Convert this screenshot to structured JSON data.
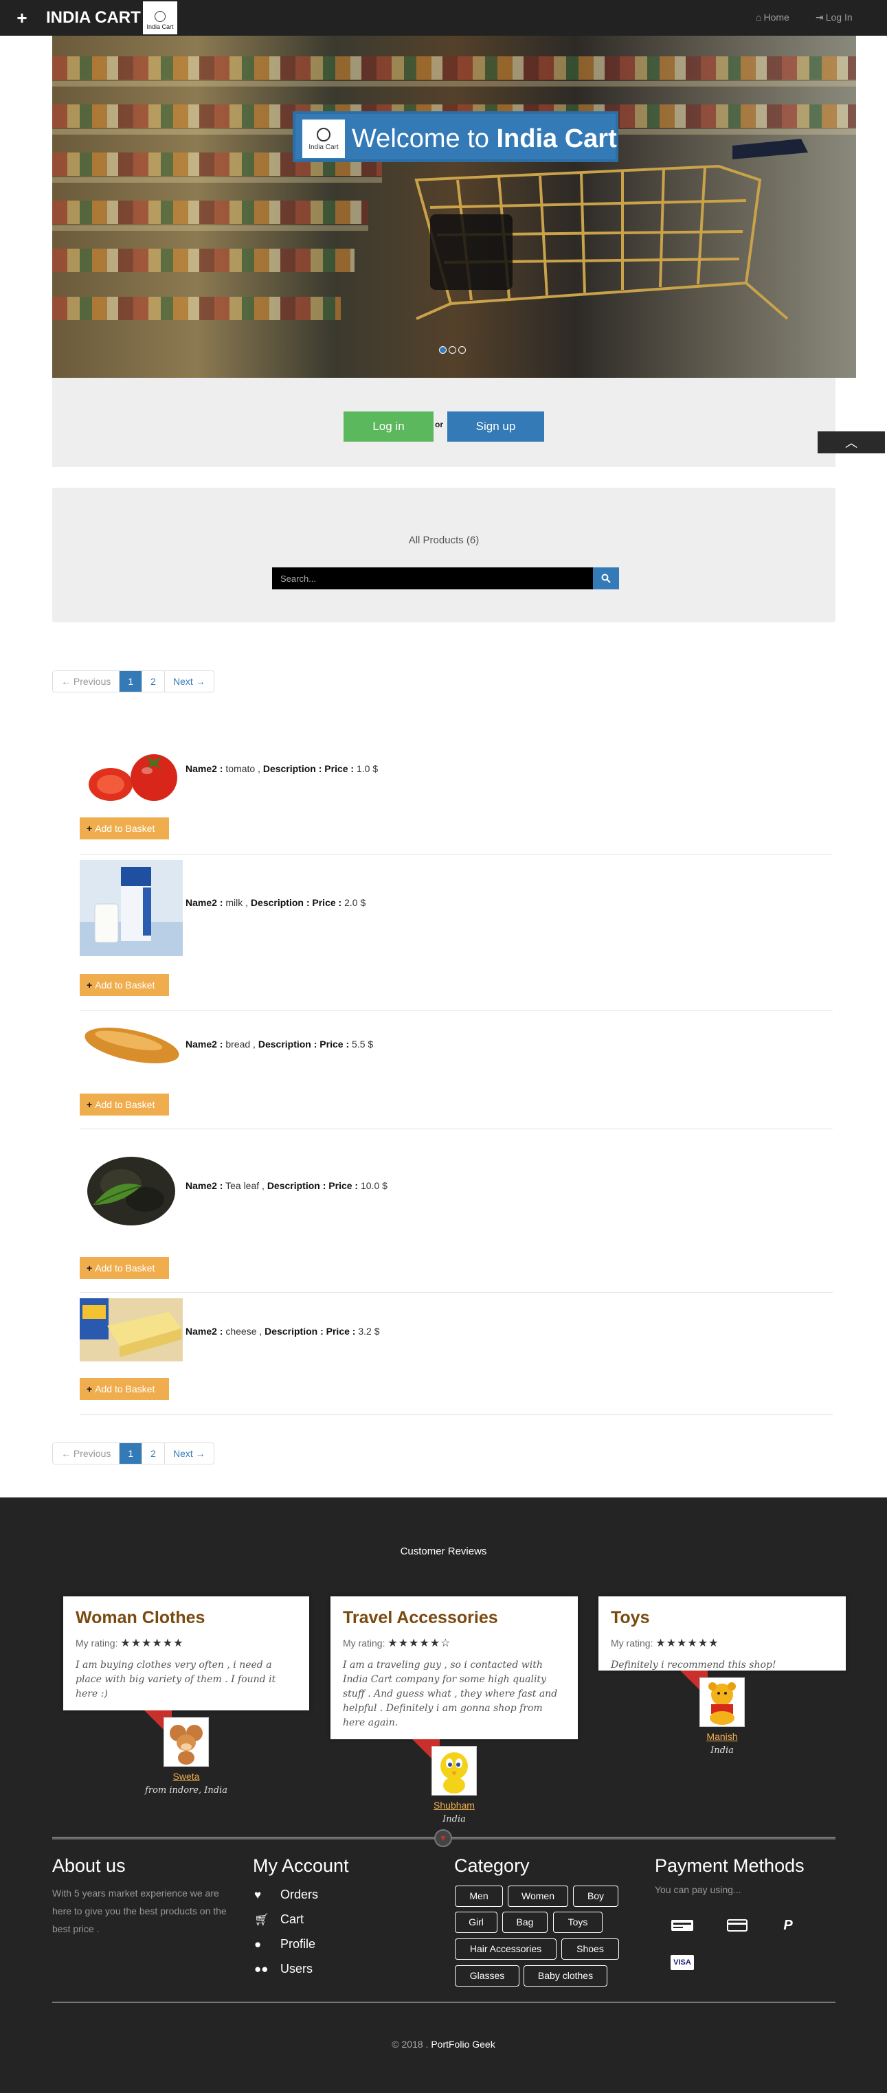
{
  "navbar": {
    "toggle_icon": "plus-icon",
    "brand": "INDIA CART",
    "logo_text": "India Cart",
    "home_label": "Home",
    "login_label": "Log In"
  },
  "hero": {
    "welcome_prefix": "Welcome to",
    "welcome_brand": "India Cart",
    "logo_text": "India Cart",
    "slide_count": 3,
    "active_slide": 1
  },
  "auth": {
    "login_label": "Log in",
    "or_label": "or",
    "signup_label": "Sign up"
  },
  "search": {
    "heading": "All Products (6)",
    "placeholder": "Search..."
  },
  "pagination": {
    "prev": "← Previous",
    "pages": [
      "1",
      "2"
    ],
    "active_page": "1",
    "next": "Next →"
  },
  "products": [
    {
      "name_label": "Name2 :",
      "name": " tomato , ",
      "desc_label": "Description :",
      "price_label": " Price :",
      "price": " 1.0 $",
      "image": "tomato-image"
    },
    {
      "name_label": "Name2 :",
      "name": " milk , ",
      "desc_label": "Description :",
      "price_label": " Price :",
      "price": " 2.0 $",
      "image": "milk-image"
    },
    {
      "name_label": "Name2 :",
      "name": " bread , ",
      "desc_label": "Description :",
      "price_label": " Price :",
      "price": " 5.5 $",
      "image": "bread-image"
    },
    {
      "name_label": "Name2 :",
      "name": " Tea leaf , ",
      "desc_label": "Description :",
      "price_label": " Price :",
      "price": " 10.0 $",
      "image": "tea-leaf-image"
    },
    {
      "name_label": "Name2 :",
      "name": " cheese , ",
      "desc_label": "Description :",
      "price_label": " Price :",
      "price": " 3.2 $",
      "image": "cheese-image"
    }
  ],
  "basket_label": "Add to Basket",
  "reviews": {
    "heading": "Customer Reviews",
    "rating_label": "My rating:",
    "items": [
      {
        "title": "Woman Clothes",
        "stars": "★★★★★★",
        "text": "I am buying clothes very often , i need a place with big variety of them . I found it here :)",
        "name": "Sweta",
        "from": "from indore, India"
      },
      {
        "title": "Travel Accessories",
        "stars": "★★★★★☆",
        "text": "I am a traveling guy , so i contacted with India Cart company for some high quality stuff . And guess what , they where fast and helpful . Definitely i am gonna shop from here again.",
        "name": "Shubham",
        "from": "India"
      },
      {
        "title": "Toys",
        "stars": "★★★★★★",
        "text": "Definitely i recommend this shop!",
        "name": "Manish",
        "from": "India"
      }
    ]
  },
  "footer": {
    "about_title": "About us",
    "about_text": "With 5 years market experience we are here to give you the best products on the best price .",
    "account_title": "My Account",
    "account_items": [
      {
        "icon": "heart-icon",
        "label": "Orders"
      },
      {
        "icon": "cart-icon",
        "label": "Cart"
      },
      {
        "icon": "user-icon",
        "label": "Profile"
      },
      {
        "icon": "users-icon",
        "label": "Users"
      }
    ],
    "category_title": "Category",
    "categories": [
      "Men",
      "Women",
      "Boy",
      "Girl",
      "Bag",
      "Toys",
      "Hair Accessories",
      "Shoes",
      "Glasses",
      "Baby clothes"
    ],
    "payment_title": "Payment Methods",
    "payment_text": "You can pay using...",
    "payment_icons": [
      "bank-card-icon",
      "credit-card-icon",
      "paypal-icon",
      "visa-icon"
    ],
    "visa_label": "VISA",
    "paypal_label": "P",
    "copyright_prefix": "© 2018 . ",
    "copyright_brand": "PortFolio Geek"
  },
  "colors": {
    "navbar": "#222222",
    "primary": "#337ab7",
    "success": "#5cb85c",
    "warning": "#f0ad4e",
    "footer": "#242424",
    "review_title": "#7a4a10"
  }
}
